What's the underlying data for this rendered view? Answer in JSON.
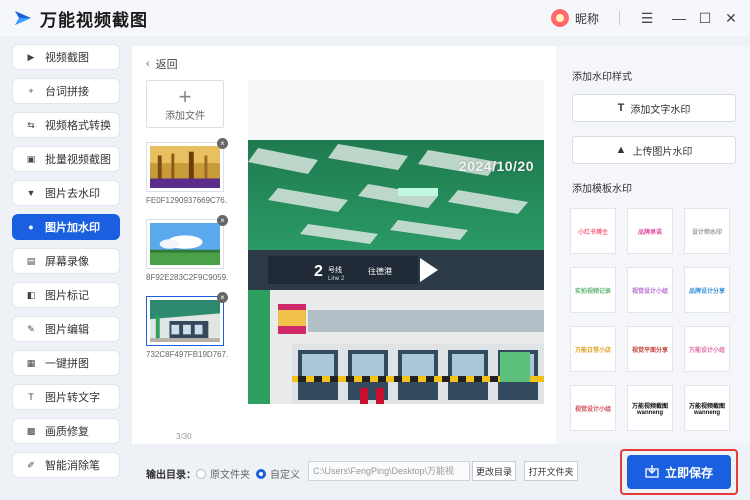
{
  "app": {
    "title": "万能视频截图",
    "user_nickname": "昵称"
  },
  "window_controls": {
    "menu": "☰",
    "minimize": "—",
    "maximize": "☐",
    "close": "✕"
  },
  "sidebar": {
    "items": [
      {
        "label": "视频截图",
        "icon": "video-screenshot-icon"
      },
      {
        "label": "台词拼接",
        "icon": "subtitle-join-icon"
      },
      {
        "label": "视频格式转换",
        "icon": "format-convert-icon"
      },
      {
        "label": "批量视频截图",
        "icon": "batch-screenshot-icon"
      },
      {
        "label": "图片去水印",
        "icon": "remove-watermark-icon"
      },
      {
        "label": "图片加水印",
        "icon": "add-watermark-icon",
        "active": true
      },
      {
        "label": "屏幕录像",
        "icon": "screen-record-icon"
      },
      {
        "label": "图片标记",
        "icon": "image-mark-icon"
      },
      {
        "label": "图片编辑",
        "icon": "image-edit-icon"
      },
      {
        "label": "一键拼图",
        "icon": "collage-icon"
      },
      {
        "label": "图片转文字",
        "icon": "ocr-icon"
      },
      {
        "label": "画质修复",
        "icon": "quality-repair-icon"
      },
      {
        "label": "智能消除笔",
        "icon": "smart-eraser-icon"
      }
    ]
  },
  "main": {
    "back_label": "返回",
    "add_file_label": "添加文件",
    "files": [
      {
        "name": "FE0F1290937669C76..."
      },
      {
        "name": "8F92E283C2F9C9059..."
      },
      {
        "name": "732C8F497FB19D767...",
        "selected": true
      }
    ],
    "counter": "3/30",
    "preview_watermark": "2024/10/20"
  },
  "right_panel": {
    "style_title": "添加水印样式",
    "add_text_watermark": "添加文字水印",
    "upload_image_watermark": "上传图片水印",
    "template_title": "添加模板水印",
    "templates": [
      {
        "text": "小红书博主",
        "color": "#ff6b8a"
      },
      {
        "text": "品牌承诺",
        "color": "#e04fa0"
      },
      {
        "text": "设计师水印",
        "color": "#999999"
      },
      {
        "text": "实拍视频记录",
        "color": "#5fb87a"
      },
      {
        "text": "视觉设计小组",
        "color": "#b86fd0"
      },
      {
        "text": "品牌设计分享",
        "color": "#3a8fd9"
      },
      {
        "text": "万能日常小店",
        "color": "#e0a020"
      },
      {
        "text": "视觉平面分享",
        "color": "#c0453a"
      },
      {
        "text": "万能设计小组",
        "color": "#e06fa8"
      },
      {
        "text": "视觉设计小组",
        "color": "#d04f5a"
      },
      {
        "text": "万能视频截图 wanneng",
        "color": "#111111"
      },
      {
        "text": "万能视频截图 wanneng",
        "color": "#111111"
      }
    ]
  },
  "bottom": {
    "output_label": "输出目录：",
    "option_original": "原文件夹",
    "option_custom": "自定义",
    "path_value": "C:\\Users\\FengPing\\Desktop\\万能视",
    "change_dir": "更改目录",
    "open_folder": "打开文件夹",
    "save_now": "立即保存"
  },
  "colors": {
    "accent": "#1a5fe0",
    "highlight": "#e53935"
  }
}
